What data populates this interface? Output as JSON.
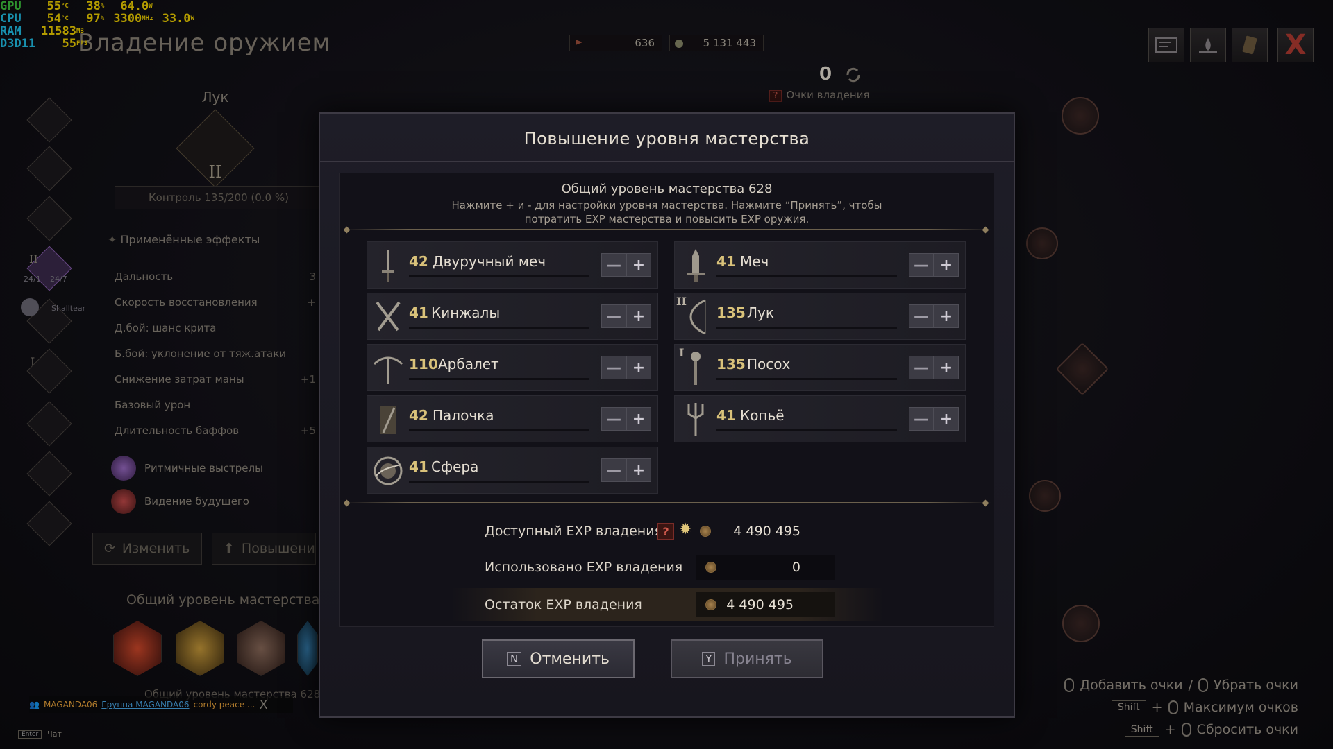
{
  "perf": {
    "gpu": {
      "label": "GPU",
      "temp": "55",
      "temp_unit": "°C",
      "load": "38",
      "load_unit": "%",
      "power": "64.0",
      "power_unit": "W"
    },
    "cpu": {
      "label": "CPU",
      "temp": "54",
      "temp_unit": "°C",
      "load": "97",
      "load_unit": "%",
      "clock": "3300",
      "clock_unit": "MHz",
      "power": "33.0",
      "power_unit": "W"
    },
    "ram": {
      "label": "RAM",
      "value": "11583",
      "unit": "MB"
    },
    "api": {
      "label": "D3D11",
      "value": "55",
      "unit": "FPS"
    }
  },
  "header": {
    "title": "Владение оружием",
    "currency_a": "636",
    "currency_b": "5 131 443",
    "points_value": "0",
    "points_help": "?",
    "points_label": "Очки владения",
    "close_label": "X"
  },
  "left_panel": {
    "weapon_name": "Лук",
    "weapon_tier": "II",
    "control": "Контроль 135/200 (0.0 %)",
    "effects_title": "Применённые эффекты",
    "effects": [
      {
        "name": "Дальность",
        "value": "3"
      },
      {
        "name": "Скорость восстановления",
        "value": "+"
      },
      {
        "name": "Д.бой: шанс крита",
        "value": ""
      },
      {
        "name": "Б.бой: уклонение от тяж.атаки",
        "value": ""
      },
      {
        "name": "Снижение затрат маны",
        "value": "+1"
      },
      {
        "name": "Базовый урон",
        "value": ""
      },
      {
        "name": "Длительность баффов",
        "value": "+5"
      }
    ],
    "skills": [
      {
        "name": "Ритмичные выстрелы",
        "icon": "rhythm-shots-icon"
      },
      {
        "name": "Видение будущего",
        "icon": "future-vision-icon"
      }
    ],
    "change_button": "Изменить",
    "upgrade_button": "Повышение",
    "mastery_label": "Общий уровень мастерства",
    "bottom_text": "Общий уровень мастерства 628",
    "rail_tiers": [
      "II",
      "I"
    ],
    "party_hp": [
      "24/1",
      "24/7"
    ],
    "party_member": "Shalltear"
  },
  "group_bar": {
    "name": "MAGANDA06",
    "group": "Группа MAGANDA06",
    "message": "cordy peace ...",
    "close": "X"
  },
  "chat_hint": {
    "key": "Enter",
    "label": "Чат"
  },
  "modal": {
    "title": "Повышение уровня мастерства",
    "total_level": "Общий уровень мастерства 628",
    "instruction_line1": "Нажмите + и - для настройки уровня мастерства. Нажмите “Принять”, чтобы",
    "instruction_line2": "потратить EXP мастерства и повысить EXP оружия.",
    "weapons": [
      {
        "level": "42",
        "name": "Двуручный меч",
        "icon": "greatsword-icon",
        "tier": ""
      },
      {
        "level": "41",
        "name": "Меч",
        "icon": "sword-icon",
        "tier": ""
      },
      {
        "level": "41",
        "name": "Кинжалы",
        "icon": "daggers-icon",
        "tier": ""
      },
      {
        "level": "135",
        "name": "Лук",
        "icon": "bow-icon",
        "tier": "II"
      },
      {
        "level": "110",
        "name": "Арбалет",
        "icon": "crossbow-icon",
        "tier": ""
      },
      {
        "level": "135",
        "name": "Посох",
        "icon": "staff-icon",
        "tier": "I"
      },
      {
        "level": "42",
        "name": "Палочка",
        "icon": "wand-icon",
        "tier": ""
      },
      {
        "level": "41",
        "name": "Копьё",
        "icon": "spear-icon",
        "tier": ""
      },
      {
        "level": "41",
        "name": "Сфера",
        "icon": "orb-icon",
        "tier": ""
      }
    ],
    "minus_label": "—",
    "plus_label": "+",
    "exp_available_label": "Доступный EXP владения",
    "exp_available_help": "?",
    "exp_available_value": "4 490 495",
    "exp_used_label": "Использовано EXP владения",
    "exp_used_value": "0",
    "exp_remaining_label": "Остаток EXP владения",
    "exp_remaining_value": "4 490 495",
    "cancel_key": "N",
    "cancel_label": "Отменить",
    "accept_key": "Y",
    "accept_label": "Принять"
  },
  "hints": {
    "add_points": "Добавить очки",
    "separator": "/",
    "remove_points": "Убрать очки",
    "shift_key": "Shift",
    "plus": "+",
    "max_points": "Максимум очков",
    "reset_points": "Сбросить очки"
  },
  "colors": {
    "accent_gold": "#d9c27a",
    "close_red": "#b23b32"
  }
}
